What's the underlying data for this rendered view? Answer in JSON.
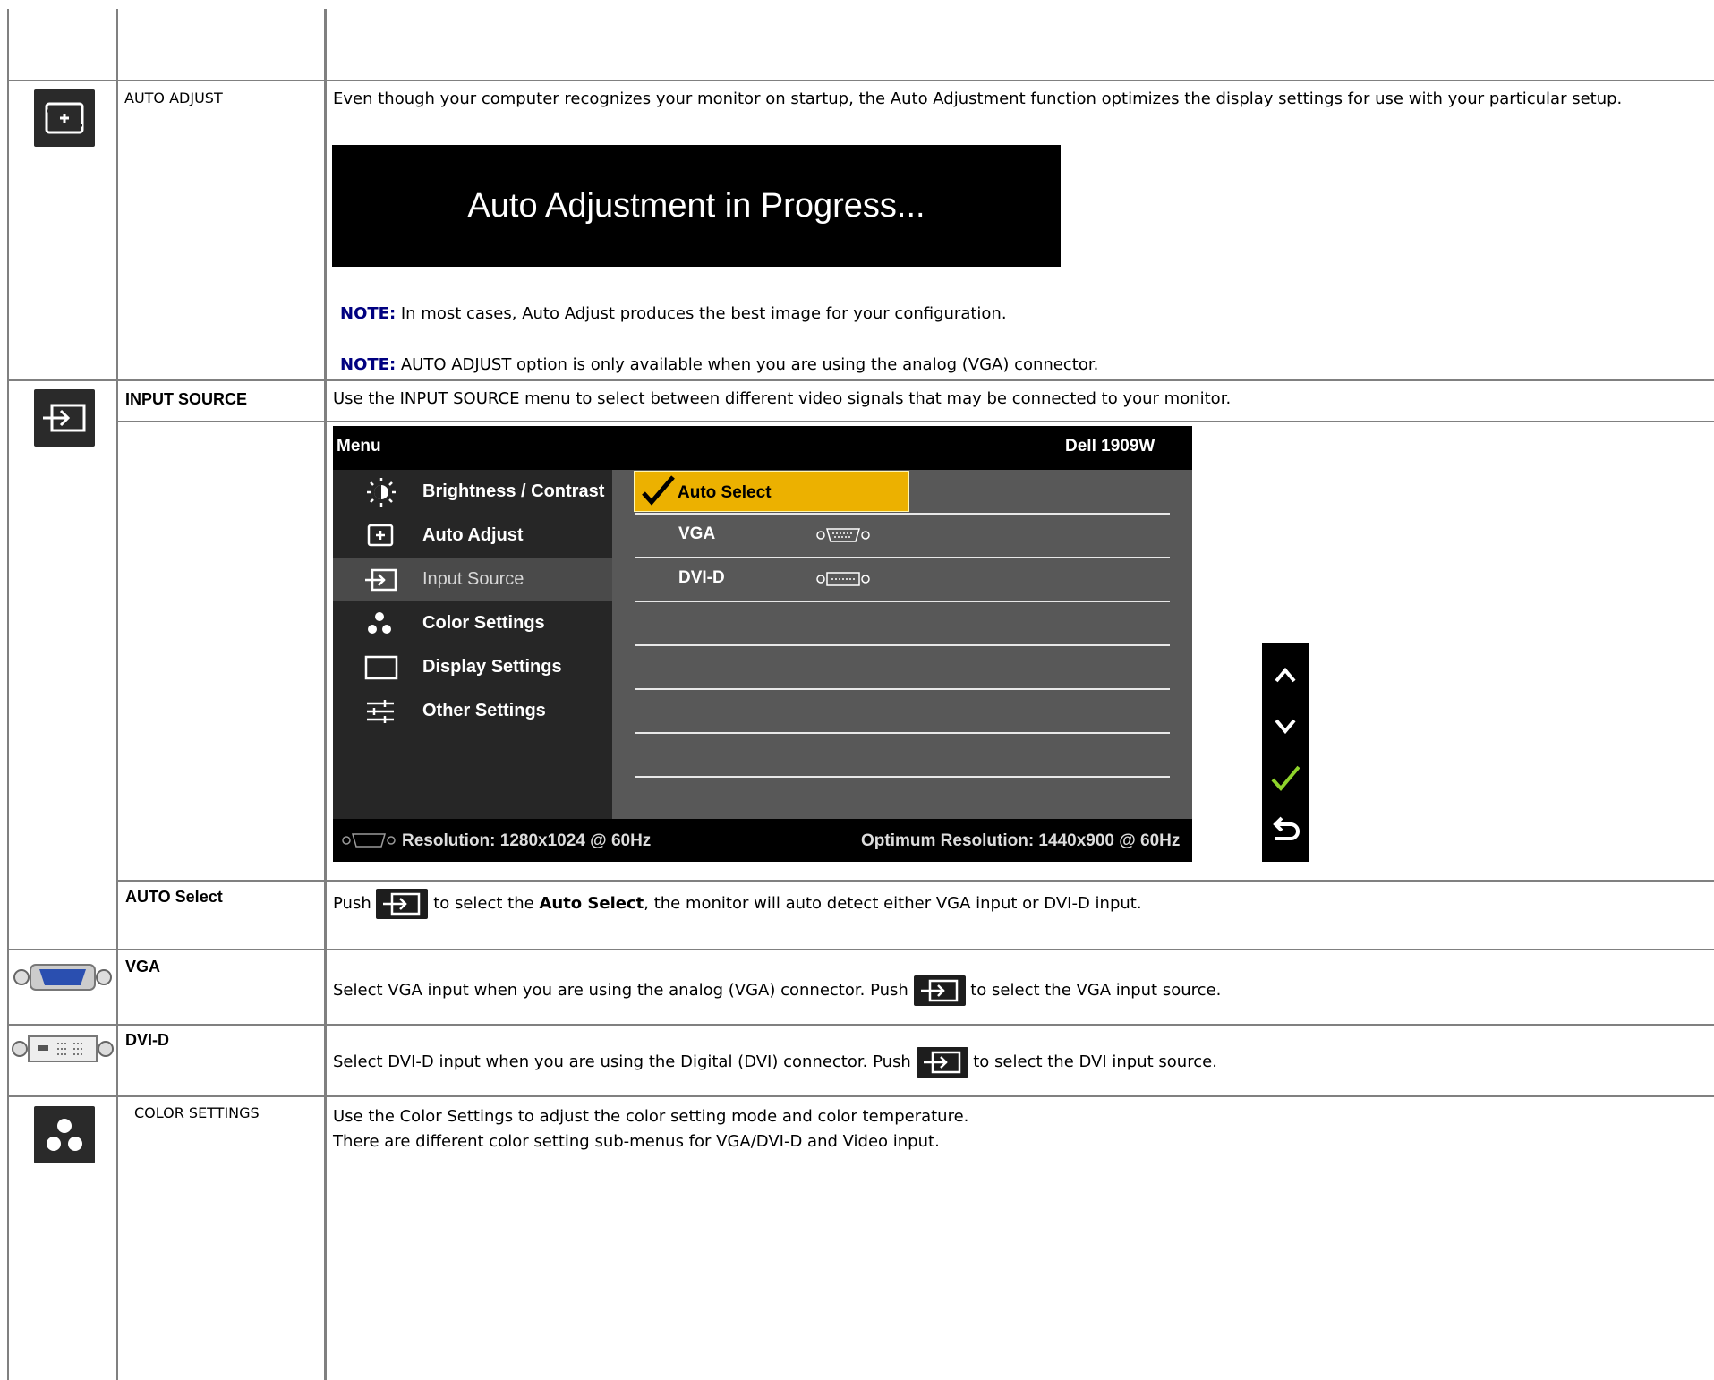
{
  "auto_adjust": {
    "label": "AUTO ADJUST",
    "icon": "auto-adjust-icon",
    "description": "Even though your computer recognizes your monitor on startup, the Auto Adjustment function optimizes the display settings for use with your particular setup.",
    "banner_text": "Auto Adjustment in Progress...",
    "note1_label": "NOTE:",
    "note1_text": " In most cases, Auto Adjust produces the best image for your configuration.",
    "note2_label": "NOTE:",
    "note2_text": " AUTO ADJUST option is only available when you are using the analog (VGA) connector."
  },
  "input_source": {
    "label": "INPUT SOURCE",
    "icon": "input-source-icon",
    "description": "Use the INPUT SOURCE menu to select between different video signals that may be connected to your monitor."
  },
  "osd": {
    "menu_title": "Menu",
    "model": "Dell 1909W",
    "items": [
      {
        "label": "Brightness / Contrast",
        "icon": "brightness-icon"
      },
      {
        "label": "Auto Adjust",
        "icon": "auto-adjust-icon"
      },
      {
        "label": "Input Source",
        "icon": "input-source-icon"
      },
      {
        "label": "Color Settings",
        "icon": "color-settings-icon"
      },
      {
        "label": "Display Settings",
        "icon": "display-settings-icon"
      },
      {
        "label": "Other Settings",
        "icon": "other-settings-icon"
      }
    ],
    "options": [
      {
        "label": "Auto Select",
        "icon": "checkmark-icon"
      },
      {
        "label": "VGA",
        "icon": "vga-connector-icon"
      },
      {
        "label": "DVI-D",
        "icon": "dvi-connector-icon"
      }
    ],
    "resolution": "Resolution: 1280x1024 @ 60Hz",
    "optimum_resolution": "Optimum Resolution: 1440x900 @ 60Hz",
    "nav_buttons": [
      "up-arrow-icon",
      "down-arrow-icon",
      "check-icon",
      "back-icon"
    ]
  },
  "auto_select": {
    "label": "AUTO Select",
    "text_before": "Push ",
    "text_mid": " to select the ",
    "bold": "Auto Select",
    "text_after": ", the monitor will auto detect either VGA input or DVI-D input."
  },
  "vga": {
    "label": "VGA",
    "icon": "vga-connector-icon",
    "text_before": "Select VGA input when you are using the analog (VGA) connector. Push ",
    "text_after": " to select the VGA input source."
  },
  "dvi": {
    "label": "DVI-D",
    "icon": "dvi-connector-icon",
    "text_before": "Select DVI-D input when you are using the Digital (DVI) connector. Push ",
    "text_after": " to select the DVI input source."
  },
  "color_settings": {
    "label": "COLOR SETTINGS",
    "icon": "color-settings-icon",
    "line1": "Use the Color Settings to adjust the color setting mode and color temperature.",
    "line2": "There are different color setting sub-menus for VGA/DVI-D and Video input."
  },
  "colors": {
    "note": "#000080",
    "grid": "#808080",
    "osd_highlight": "#ecb100",
    "nav_check": "#8fd42b"
  }
}
